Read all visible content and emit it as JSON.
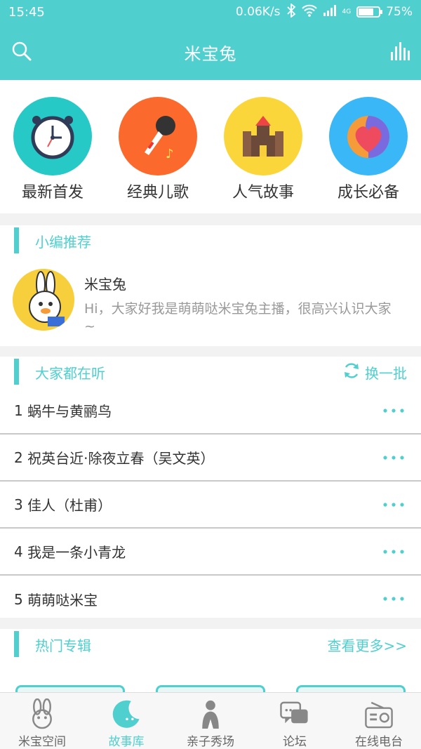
{
  "status": {
    "time": "15:45",
    "speed": "0.06K/s",
    "network": "4G",
    "battery": "75%",
    "battery_level": 0.75
  },
  "header": {
    "title": "米宝兔"
  },
  "categories": [
    {
      "label": "最新首发",
      "icon": "clock-icon",
      "color": "#26c9c5"
    },
    {
      "label": "经典儿歌",
      "icon": "microphone-icon",
      "color": "#fb6a2c"
    },
    {
      "label": "人气故事",
      "icon": "castle-icon",
      "color": "#fbd63a"
    },
    {
      "label": "成长必备",
      "icon": "heart-icon",
      "color": "#39b7f7"
    }
  ],
  "recommend": {
    "title": "小编推荐",
    "name": "米宝兔",
    "desc": "Hi，大家好我是萌萌哒米宝兔主播，很高兴认识大家~"
  },
  "listening": {
    "title": "大家都在听",
    "refresh_label": "换一批",
    "items": [
      {
        "rank": "1",
        "title": "蜗牛与黄鹂鸟"
      },
      {
        "rank": "2",
        "title": "祝英台近·除夜立春（吴文英）"
      },
      {
        "rank": "3",
        "title": "佳人（杜甫）"
      },
      {
        "rank": "4",
        "title": "我是一条小青龙"
      },
      {
        "rank": "5",
        "title": "萌萌哒米宝"
      }
    ]
  },
  "albums": {
    "title": "热门专辑",
    "more_label": "查看更多>>"
  },
  "tabs": [
    {
      "label": "米宝空间",
      "icon": "rabbit-icon"
    },
    {
      "label": "故事库",
      "icon": "moon-icon",
      "active": true
    },
    {
      "label": "亲子秀场",
      "icon": "person-icon"
    },
    {
      "label": "论坛",
      "icon": "chat-bubble-icon"
    },
    {
      "label": "在线电台",
      "icon": "radio-icon"
    }
  ],
  "colors": {
    "accent": "#4fd0cf",
    "text": "#333333",
    "muted": "#999999"
  }
}
